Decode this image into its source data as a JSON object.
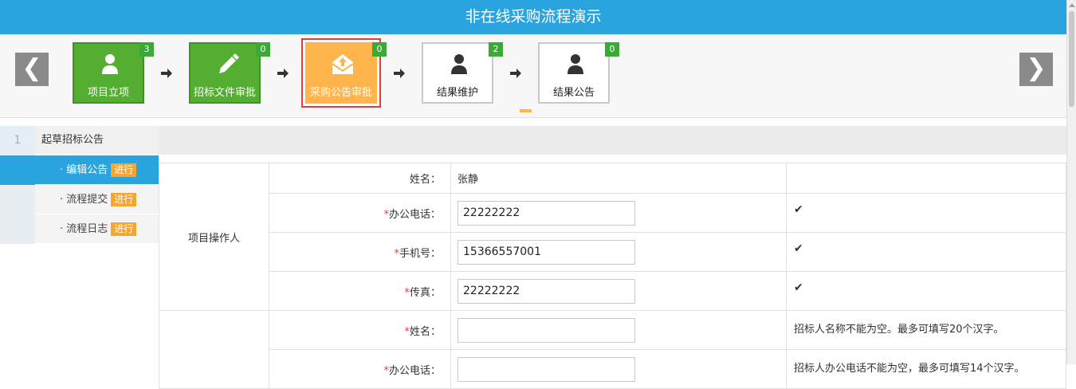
{
  "header": {
    "title": "非在线采购流程演示"
  },
  "nav": {
    "prev": "❮",
    "next": "❯"
  },
  "steps": [
    {
      "label": "项目立项",
      "count": "3",
      "state": "done",
      "icon": "user-icon"
    },
    {
      "label": "招标文件审批",
      "count": "0",
      "state": "done",
      "icon": "pencil-icon"
    },
    {
      "label": "采购公告审批",
      "count": "0",
      "state": "active",
      "icon": "mail-upload-icon"
    },
    {
      "label": "结果维护",
      "count": "2",
      "state": "todo",
      "icon": "user-icon"
    },
    {
      "label": "结果公告",
      "count": "0",
      "state": "todo",
      "icon": "user-icon"
    }
  ],
  "sidebar": {
    "section_num": "1",
    "section_title": "起草招标公告",
    "items": [
      {
        "label": "· 编辑公告",
        "tag": "进行"
      },
      {
        "label": "· 流程提交",
        "tag": "进行"
      },
      {
        "label": "· 流程日志",
        "tag": "进行"
      }
    ]
  },
  "form": {
    "group1": "项目操作人",
    "rows": [
      {
        "label": "姓名：",
        "value": "张静",
        "msg": ""
      },
      {
        "label": "办公电话：",
        "required": "*",
        "value": "22222222",
        "msg": "✔"
      },
      {
        "label": "手机号：",
        "required": "*",
        "value": "15366557001",
        "msg": "✔"
      },
      {
        "label": "传真：",
        "required": "*",
        "value": "22222222",
        "msg": "✔"
      },
      {
        "label": "姓名：",
        "required": "*",
        "value": "",
        "msg": "招标人名称不能为空。最多可填写20个汉字。"
      },
      {
        "label": "办公电话：",
        "required": "*",
        "value": "",
        "msg": "招标人办公电话不能为空，最多可填写14个汉字。"
      }
    ]
  },
  "colors": {
    "header": "#2aa4de",
    "done": "#53ae32",
    "active": "#ffb54b",
    "badge": "#3aa935",
    "tag": "#f7a531",
    "error_outline": "#e23d3d"
  }
}
